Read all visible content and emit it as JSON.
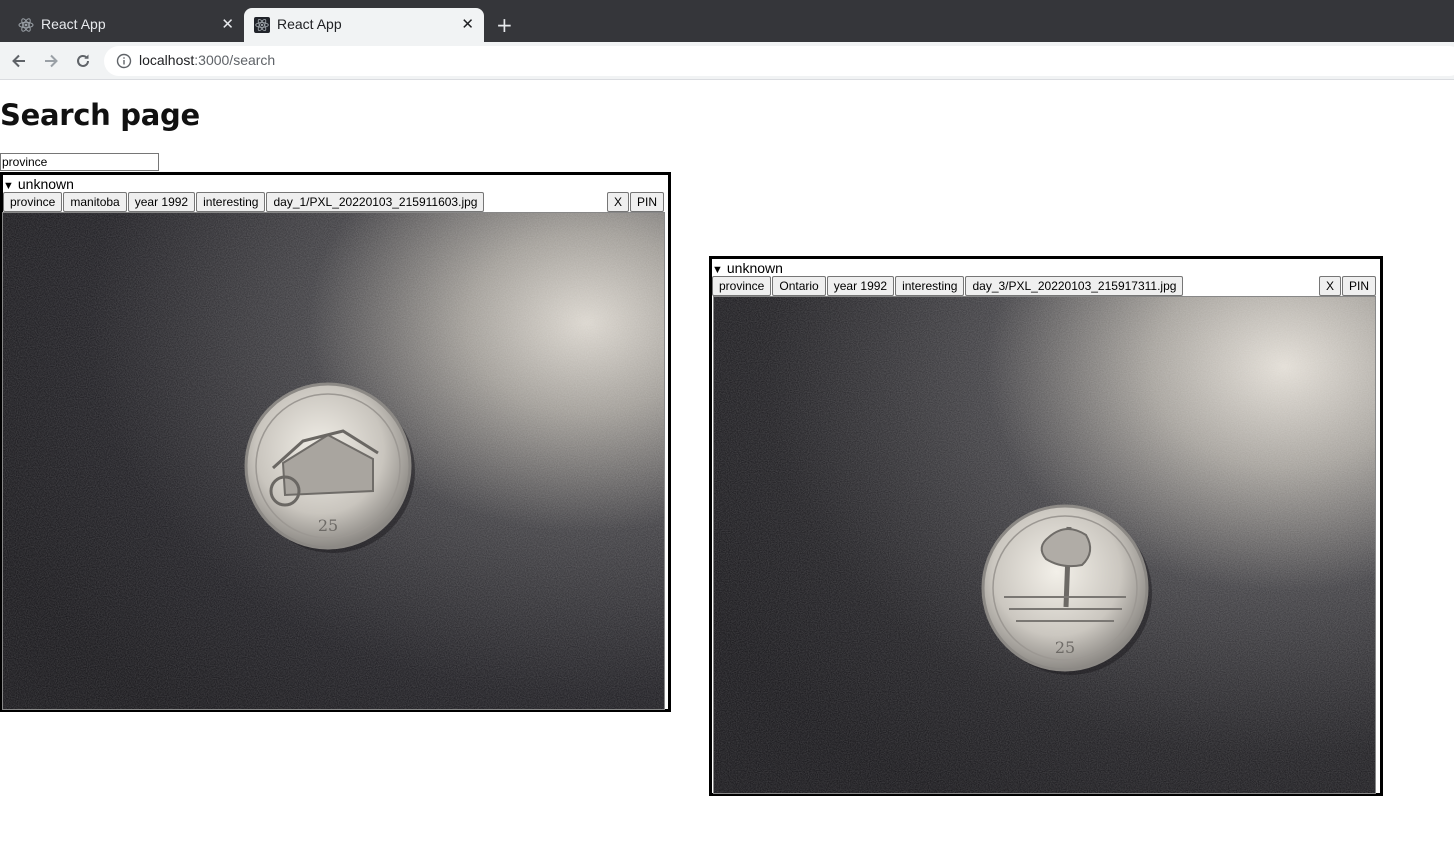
{
  "browser": {
    "tabs": [
      {
        "title": "React App",
        "active": false
      },
      {
        "title": "React App",
        "active": true
      }
    ],
    "url_host": "localhost",
    "url_path": ":3000/search"
  },
  "page": {
    "title": "Search page",
    "search_value": "province"
  },
  "cards": [
    {
      "summary": "unknown",
      "tags": [
        "province",
        "manitoba",
        "year 1992",
        "interesting",
        "day_1/PXL_20220103_215911603.jpg"
      ],
      "remove_label": "X",
      "pin_label": "PIN",
      "image_alt": "Manitoba 1992 25 cent coin"
    },
    {
      "summary": "unknown",
      "tags": [
        "province",
        "Ontario",
        "year 1992",
        "interesting",
        "day_3/PXL_20220103_215917311.jpg"
      ],
      "remove_label": "X",
      "pin_label": "PIN",
      "image_alt": "Ontario 1992 25 cent coin"
    }
  ]
}
